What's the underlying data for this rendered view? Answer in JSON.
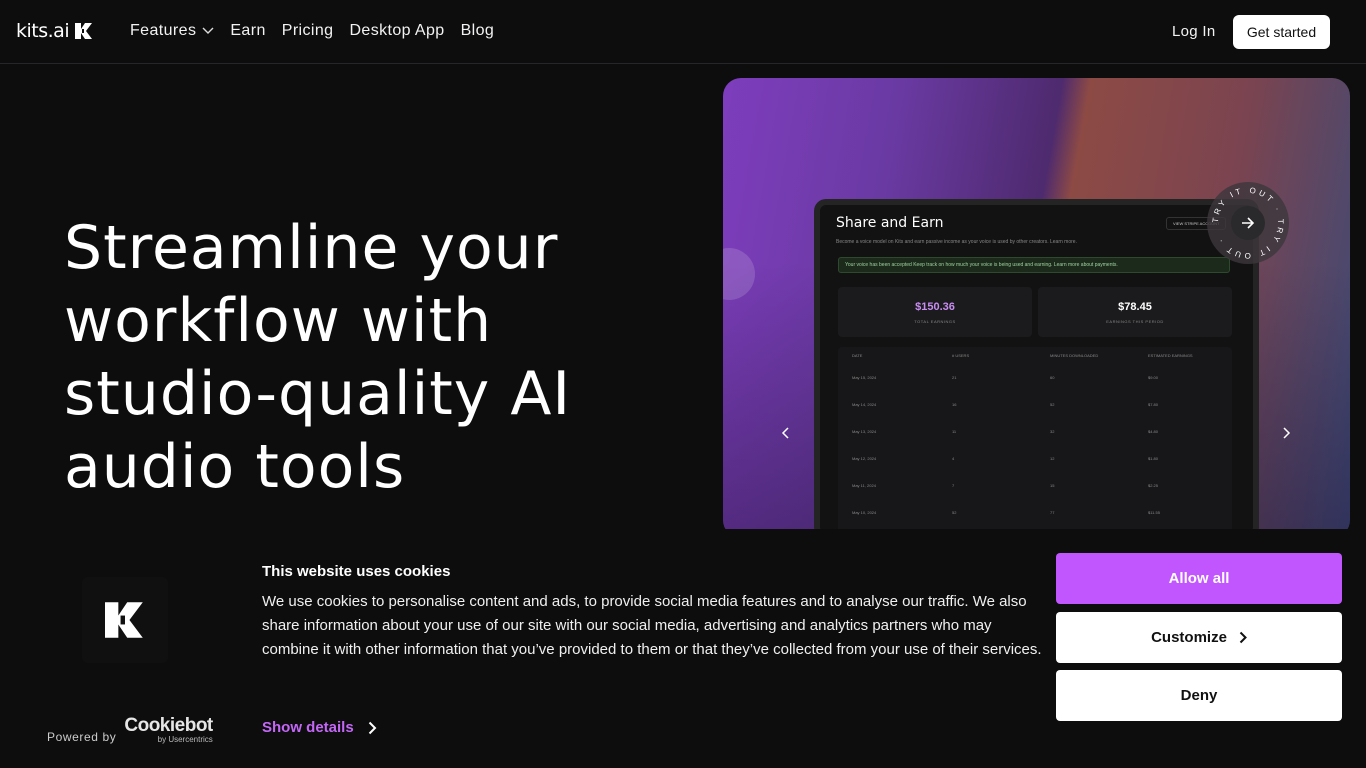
{
  "nav": {
    "logo_text": "kits.ai",
    "links": [
      "Features",
      "Earn",
      "Pricing",
      "Desktop App",
      "Blog"
    ],
    "login": "Log In",
    "cta": "Get started"
  },
  "hero": {
    "headline": "Streamline your workflow with studio-quality AI audio tools",
    "badge_text": "TRY IT OUT · TRY IT OUT ·",
    "app": {
      "title": "Share and Earn",
      "subtitle": "Become a voice model on Kits and earn passive income as your voice is used by other creators. Learn more.",
      "button": "VIEW STRIPE ACCOUNT",
      "notice": "Your voice has been accepted   Keep track on how much your voice is being used and earning. Learn more about payments.",
      "stats": [
        {
          "value": "$150.36",
          "label": "TOTAL EARNINGS"
        },
        {
          "value": "$78.45",
          "label": "EARNINGS THIS PERIOD"
        }
      ],
      "table_headers": [
        "DATE",
        "# USERS",
        "MINUTES DOWNLOADED",
        "ESTIMATED EARNINGS"
      ],
      "rows": [
        [
          "May 15, 2024",
          "21",
          "60",
          "$9.00"
        ],
        [
          "May 14, 2024",
          "16",
          "52",
          "$7.80"
        ],
        [
          "May 13, 2024",
          "11",
          "32",
          "$4.80"
        ],
        [
          "May 12, 2024",
          "4",
          "12",
          "$1.80"
        ],
        [
          "May 11, 2024",
          "7",
          "15",
          "$2.25"
        ],
        [
          "May 10, 2024",
          "52",
          "77",
          "$11.55"
        ]
      ]
    }
  },
  "cookie": {
    "title": "This website uses cookies",
    "text": "We use cookies to personalise content and ads, to provide social media features and to analyse our traffic. We also share information about your use of our site with our social media, advertising and analytics partners who may combine it with other information that you’ve provided to them or that they’ve collected from your use of their services.",
    "show_details": "Show details",
    "powered_by": "Powered by",
    "brand": "Cookiebot",
    "brand_sub": "by Usercentrics",
    "allow_all": "Allow all",
    "customize": "Customize",
    "deny": "Deny",
    "accent": "#c156ff"
  }
}
